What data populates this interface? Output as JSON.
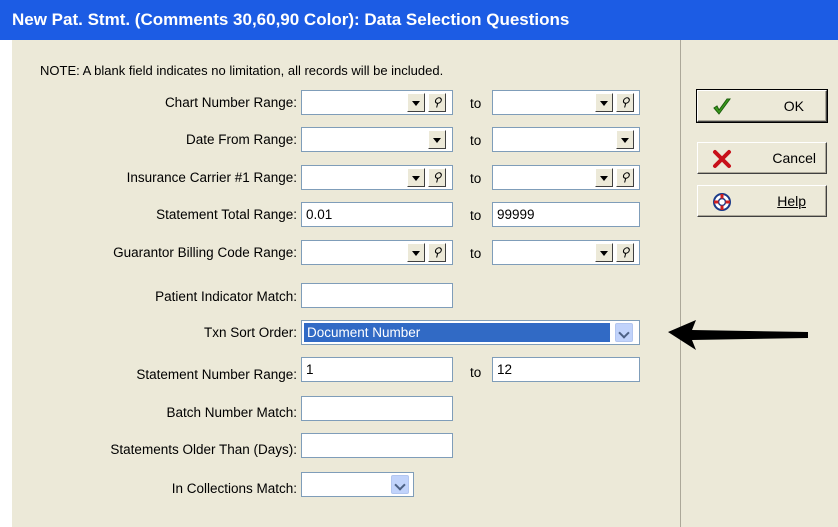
{
  "window": {
    "title": "New Pat. Stmt. (Comments 30,60,90 Color): Data Selection Questions"
  },
  "note": "NOTE: A blank field indicates no limitation,  all records will be included.",
  "to_label": "to",
  "fields": {
    "chart_number_range": {
      "label": "Chart Number Range:",
      "from": "",
      "to": ""
    },
    "date_from_range": {
      "label": "Date From Range:",
      "from": "",
      "to": ""
    },
    "insurance_carrier_range": {
      "label": "Insurance Carrier #1 Range:",
      "from": "",
      "to": ""
    },
    "statement_total_range": {
      "label": "Statement Total Range:",
      "from": "0.01",
      "to": "99999"
    },
    "guarantor_billing_code_range": {
      "label": "Guarantor Billing Code Range:",
      "from": "",
      "to": ""
    },
    "patient_indicator_match": {
      "label": "Patient Indicator Match:",
      "value": ""
    },
    "txn_sort_order": {
      "label": "Txn Sort Order:",
      "value": "Document Number"
    },
    "statement_number_range": {
      "label": "Statement Number Range:",
      "from": "1",
      "to": "12"
    },
    "batch_number_match": {
      "label": "Batch Number Match:",
      "value": ""
    },
    "statements_older_than": {
      "label": "Statements Older Than (Days):",
      "value": ""
    },
    "in_collections_match": {
      "label": "In Collections Match:",
      "value": ""
    }
  },
  "buttons": {
    "ok": "OK",
    "cancel": "Cancel",
    "help": "Help"
  },
  "colors": {
    "titlebar": "#1c5ce4",
    "selection": "#316ac5",
    "dialog_bg": "#ece9d8"
  },
  "icons": {
    "ok": "green-checkmark-icon",
    "cancel": "red-x-icon",
    "help": "lifebuoy-icon",
    "lookup": "magnifier-icon",
    "annotation": "black-arrow"
  }
}
